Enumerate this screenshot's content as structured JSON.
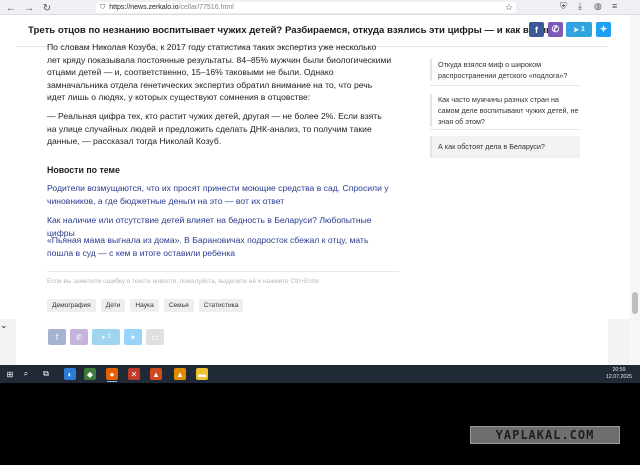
{
  "browser": {
    "url_host": "https://news.zerkalo.io",
    "url_path": "/cellar/77516.html",
    "icons": [
      "back-arrow-icon",
      "forward-arrow-icon",
      "reload-icon",
      "shield-icon",
      "star-icon",
      "download-icon"
    ]
  },
  "header": {
    "title": "Треть отцов по незнанию воспитывает чужих детей? Разбираемся, откуда взялись эти цифры — и как велика",
    "telegram_count": "1"
  },
  "article": {
    "paragraph1": "По словам Николая Козуба, к 2017 году статистика таких экспертиз уже несколько лет кряду показывала постоянные результаты. 84–85% мужчин были биологическими отцами детей — и, соответственно, 15–16% таковыми не были. Однако замначальника отдела генетических экспертиз обратил внимание на то, что речь идет лишь о людях, у которых существуют сомнения в отцовстве:",
    "paragraph2": "— Реальная цифра тех, кто растит чужих детей, другая — не более 2%. Если взять на улице случайных людей и предложить сделать ДНК-анализ, то получим такие данные, — рассказал тогда Николай Козуб.",
    "news_heading": "Новости по теме",
    "links": [
      "Родители возмущаются, что их просят принести моющие средства в сад. Спросили у чиновников, а где бюджетные деньги на это — вот их ответ",
      "Как наличие или отсутствие детей влияет на бедность в Беларуси? Любопытные цифры",
      "«Пьяная мама выгнала из дома». В Барановичах подросток сбежал к отцу, мать пошла в суд — с кем в итоге оставили ребенка"
    ],
    "error_notice": "Если вы заметили ошибку в тексте новости, пожалуйста, выделите её и нажмите Ctrl+Enter",
    "tags": [
      "Демография",
      "Дети",
      "Наука",
      "Семья",
      "Статистика"
    ]
  },
  "sidebar": {
    "items": [
      "Откуда взялся миф о широком распространении детского «подлога»?",
      "Как часто мужчины разных стран на самом деле воспитывают чужих детей, не зная об этом?",
      "А как обстоят дела в Беларуси?"
    ]
  },
  "bottom_share": {
    "telegram_count": "1"
  },
  "taskbar": {
    "time": "20:59",
    "date": "12.07.2025"
  },
  "watermark": "YAPLAKAL.COM",
  "colors": {
    "facebook": "#3b5998",
    "viber": "#7d5ab5",
    "telegram": "#2fa4e0",
    "twitter": "#1da1f2",
    "link": "#2a3a8f",
    "taskbar": "#1f2a36"
  }
}
